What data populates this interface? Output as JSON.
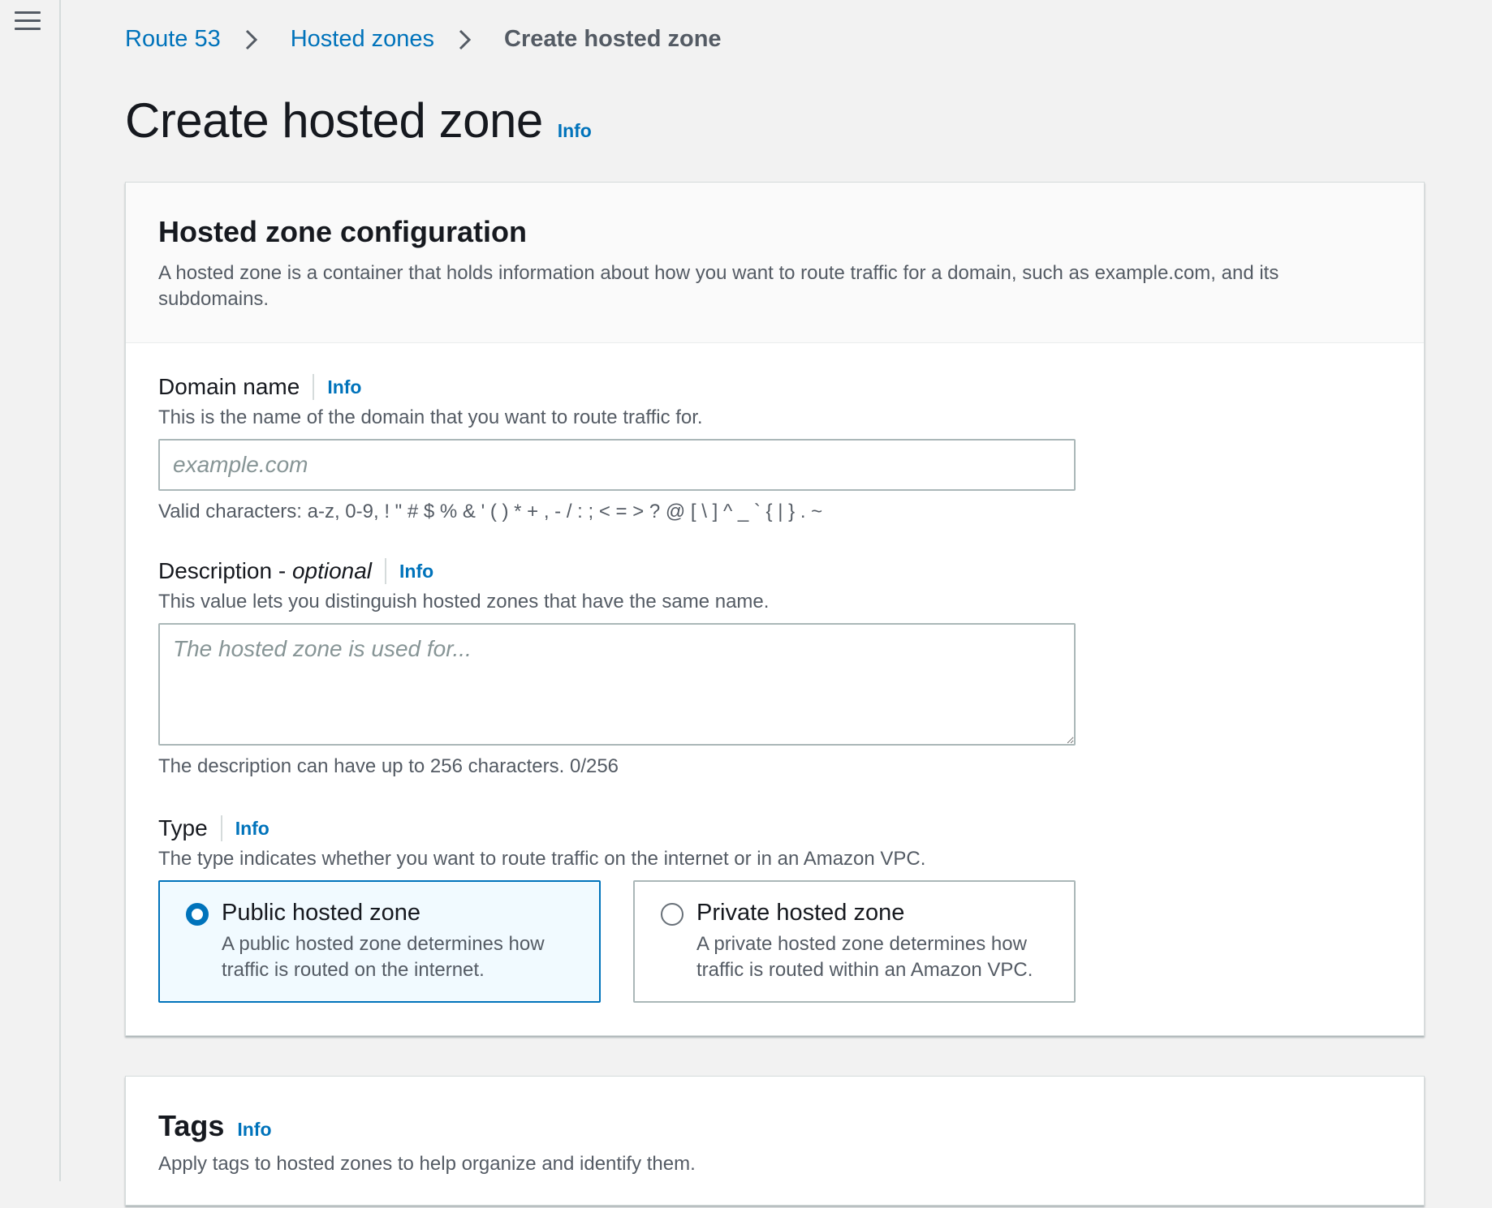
{
  "breadcrumb": {
    "items": [
      "Route 53",
      "Hosted zones"
    ],
    "current": "Create hosted zone"
  },
  "page": {
    "title": "Create hosted zone",
    "info_label": "Info"
  },
  "config": {
    "title": "Hosted zone configuration",
    "description": "A hosted zone is a container that holds information about how you want to route traffic for a domain, such as example.com, and its subdomains.",
    "domain": {
      "label": "Domain name",
      "info": "Info",
      "description": "This is the name of the domain that you want to route traffic for.",
      "placeholder": "example.com",
      "value": "",
      "constraint": "Valid characters: a-z, 0-9, ! \" # $ % & ' ( ) * + , - / : ; < = > ? @ [ \\ ] ^ _ ` { | } . ~"
    },
    "description_field": {
      "label": "Description - ",
      "label_optional": "optional",
      "info": "Info",
      "description": "This value lets you distinguish hosted zones that have the same name.",
      "placeholder": "The hosted zone is used for...",
      "value": "",
      "constraint": "The description can have up to 256 characters. 0/256"
    },
    "type": {
      "label": "Type",
      "info": "Info",
      "description": "The type indicates whether you want to route traffic on the internet or in an Amazon VPC.",
      "selected": "public",
      "options": [
        {
          "id": "public",
          "title": "Public hosted zone",
          "description": "A public hosted zone determines how traffic is routed on the internet."
        },
        {
          "id": "private",
          "title": "Private hosted zone",
          "description": "A private hosted zone determines how traffic is routed within an Amazon VPC."
        }
      ]
    }
  },
  "tags": {
    "title": "Tags",
    "info": "Info",
    "description": "Apply tags to hosted zones to help organize and identify them."
  },
  "colors": {
    "link": "#0073bb",
    "selected_bg": "#f1faff",
    "text": "#16191f",
    "secondary_text": "#545b64",
    "border": "#aab7b8"
  },
  "icons": [
    "menu-icon",
    "chevron-right-icon"
  ]
}
